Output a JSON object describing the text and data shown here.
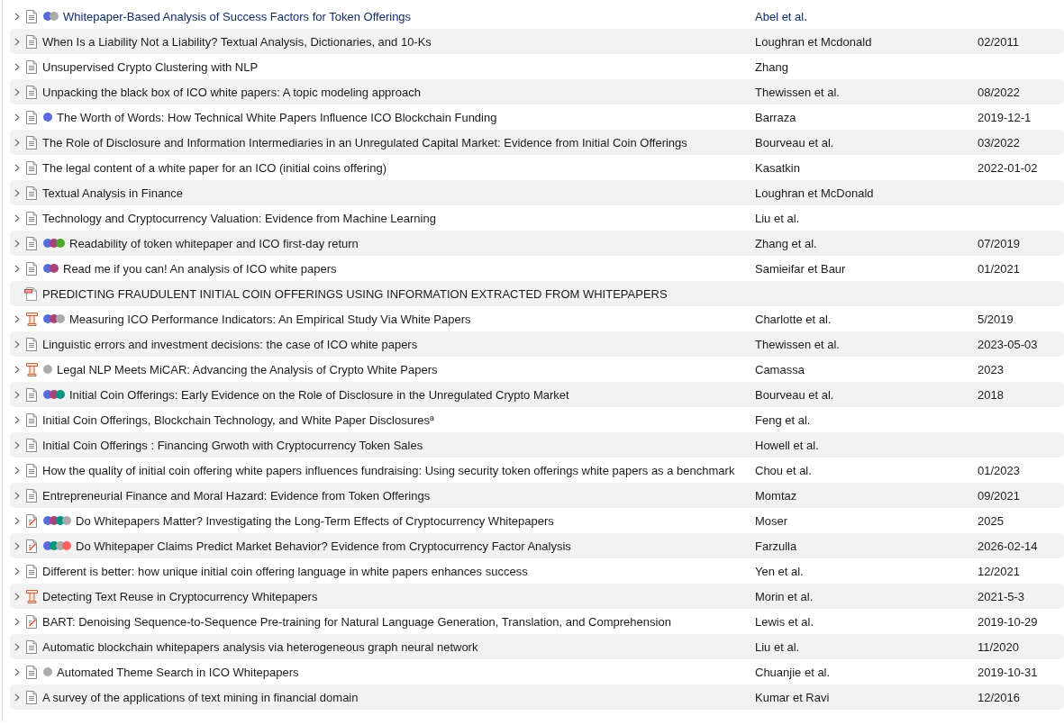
{
  "rows": [
    {
      "kind": "document",
      "expandable": true,
      "focused": true,
      "tags": [
        {
          "color": "#5b6bdc"
        },
        {
          "color": "#aaaaaa"
        }
      ],
      "title": "Whitepaper-Based Analysis of Success Factors for Token Offerings",
      "creator": "Abel et al."
    },
    {
      "kind": "document",
      "expandable": true,
      "focused": false,
      "title": "When Is a Liability Not a Liability? Textual Analysis, Dictionaries, and 10-Ks",
      "creator": "Loughran et Mcdonald",
      "date": "02/2011"
    },
    {
      "kind": "document",
      "expandable": true,
      "focused": false,
      "title": "Unsupervised Crypto Clustering with NLP",
      "creator": "Zhang"
    },
    {
      "kind": "document",
      "expandable": true,
      "focused": false,
      "title": "Unpacking the black box of ICO white papers: A topic modeling approach",
      "creator": "Thewissen et al.",
      "date": "08/2022"
    },
    {
      "kind": "document",
      "expandable": true,
      "focused": false,
      "tags": [
        {
          "color": "#5b6bdc"
        }
      ],
      "title": "The Worth of Words: How Technical White Papers Influence ICO Blockchain Funding",
      "creator": "Barraza",
      "date": "2019-12-1"
    },
    {
      "kind": "document",
      "expandable": true,
      "focused": false,
      "title": "The Role of Disclosure and Information Intermediaries in an Unregulated Capital Market: Evidence from Initial Coin Offerings",
      "creator": "Bourveau et al.",
      "date": "03/2022"
    },
    {
      "kind": "document",
      "expandable": true,
      "focused": false,
      "title": "The legal content of a white paper for an ICO (initial coins offering)",
      "creator": "Kasatkin",
      "date": "2022-01-02"
    },
    {
      "kind": "document",
      "expandable": true,
      "focused": false,
      "title": "Textual Analysis in Finance",
      "creator": "Loughran et McDonald"
    },
    {
      "kind": "document",
      "expandable": true,
      "focused": false,
      "title": "Technology and Cryptocurrency Valuation: Evidence from Machine Learning",
      "creator": "Liu et al."
    },
    {
      "kind": "document",
      "expandable": true,
      "focused": false,
      "tags": [
        {
          "color": "#5b6bdc"
        },
        {
          "color": "#a8427a"
        },
        {
          "color": "#4aa82c"
        }
      ],
      "title": "Readability of token whitepaper and ICO first-day return",
      "creator": "Zhang et al.",
      "date": "07/2019"
    },
    {
      "kind": "document",
      "expandable": true,
      "focused": false,
      "tags": [
        {
          "color": "#5b6bdc"
        },
        {
          "color": "#a8427a"
        }
      ],
      "title": "Read me if you can! An analysis of ICO white papers",
      "creator": "Samieifar et Baur",
      "date": "01/2021"
    },
    {
      "kind": "pdf",
      "expandable": false,
      "focused": false,
      "title": "PREDICTING FRAUDULENT INITIAL COIN OFFERINGS USING INFORMATION EXTRACTED FROM WHITEPAPERS"
    },
    {
      "kind": "presentation",
      "expandable": true,
      "focused": false,
      "tags": [
        {
          "color": "#5b6bdc"
        },
        {
          "color": "#a8427a"
        },
        {
          "color": "#aaaaaa"
        }
      ],
      "title": "Measuring ICO Performance Indicators: An Empirical Study Via White Papers",
      "creator": "Charlotte et al.",
      "date": "5/2019"
    },
    {
      "kind": "document",
      "expandable": true,
      "focused": false,
      "title": "Linguistic errors and investment decisions: the case of ICO white papers",
      "creator": "Thewissen et al.",
      "date": "2023-05-03"
    },
    {
      "kind": "presentation",
      "expandable": true,
      "focused": false,
      "tags": [
        {
          "color": "#aaaaaa"
        }
      ],
      "title": "Legal NLP Meets MiCAR: Advancing the Analysis of Crypto White Papers",
      "creator": "Camassa",
      "date": "2023"
    },
    {
      "kind": "document",
      "expandable": true,
      "focused": false,
      "tags": [
        {
          "color": "#5b6bdc"
        },
        {
          "color": "#a8427a"
        },
        {
          "color": "#00987c"
        }
      ],
      "title": "Initial Coin Offerings: Early Evidence on the Role of Disclosure in the Unregulated Crypto Market",
      "creator": "Bourveau et al.",
      "date": "2018"
    },
    {
      "kind": "document",
      "expandable": true,
      "focused": false,
      "title": "Initial Coin Offerings, Blockchain Technology, and White Paper Disclosuresª",
      "creator": "Feng et al."
    },
    {
      "kind": "document",
      "expandable": true,
      "focused": false,
      "title": "Initial Coin Offerings : Financing Grwoth with Cryptocurrency Token Sales",
      "creator": "Howell et al."
    },
    {
      "kind": "document",
      "expandable": true,
      "focused": false,
      "title": "How the quality of initial coin offering white papers influences fundraising: Using security token offerings white papers as a benchmark",
      "creator": "Chou et al.",
      "date": "01/2023"
    },
    {
      "kind": "document",
      "expandable": true,
      "focused": false,
      "title": "Entrepreneurial Finance and Moral Hazard: Evidence from Token Offerings",
      "creator": "Momtaz",
      "date": "09/2021"
    },
    {
      "kind": "preprint",
      "expandable": true,
      "focused": false,
      "tags": [
        {
          "color": "#5b6bdc"
        },
        {
          "color": "#a8427a"
        },
        {
          "color": "#00987c"
        },
        {
          "color": "#aaaaaa"
        }
      ],
      "title": "Do Whitepapers Matter? Investigating the Long-Term Effects of Cryptocurrency Whitepapers",
      "creator": "Moser",
      "date": "2025"
    },
    {
      "kind": "preprint",
      "expandable": true,
      "focused": false,
      "tags": [
        {
          "color": "#5b6bdc"
        },
        {
          "color": "#00987c"
        },
        {
          "color": "#aaaaaa"
        },
        {
          "color": "#ff6262"
        }
      ],
      "title": "Do Whitepaper Claims Predict Market Behavior? Evidence from Cryptocurrency Factor Analysis",
      "creator": "Farzulla",
      "date": "2026-02-14"
    },
    {
      "kind": "document",
      "expandable": true,
      "focused": false,
      "title": "Different is better: how unique initial coin offering language in white papers enhances success",
      "creator": "Yen et al.",
      "date": "12/2021"
    },
    {
      "kind": "presentation",
      "expandable": true,
      "focused": false,
      "title": "Detecting Text Reuse in Cryptocurrency Whitepapers",
      "creator": "Morin et al.",
      "date": "2021-5-3"
    },
    {
      "kind": "preprint",
      "expandable": true,
      "focused": false,
      "title": "BART: Denoising Sequence-to-Sequence Pre-training for Natural Language Generation, Translation, and Comprehension",
      "creator": "Lewis et al.",
      "date": "2019-10-29"
    },
    {
      "kind": "document",
      "expandable": true,
      "focused": false,
      "title": "Automatic blockchain whitepapers analysis via heterogeneous graph neural network",
      "creator": "Liu et al.",
      "date": "11/2020"
    },
    {
      "kind": "document",
      "expandable": true,
      "focused": false,
      "tags": [
        {
          "color": "#aaaaaa"
        }
      ],
      "title": "Automated Theme Search in ICO Whitepapers",
      "creator": "Chuanjie et al.",
      "date": "2019-10-31"
    },
    {
      "kind": "document",
      "expandable": true,
      "focused": false,
      "title": "A survey of the applications of text mining in financial domain",
      "creator": "Kumar et Ravi",
      "date": "12/2016"
    }
  ]
}
